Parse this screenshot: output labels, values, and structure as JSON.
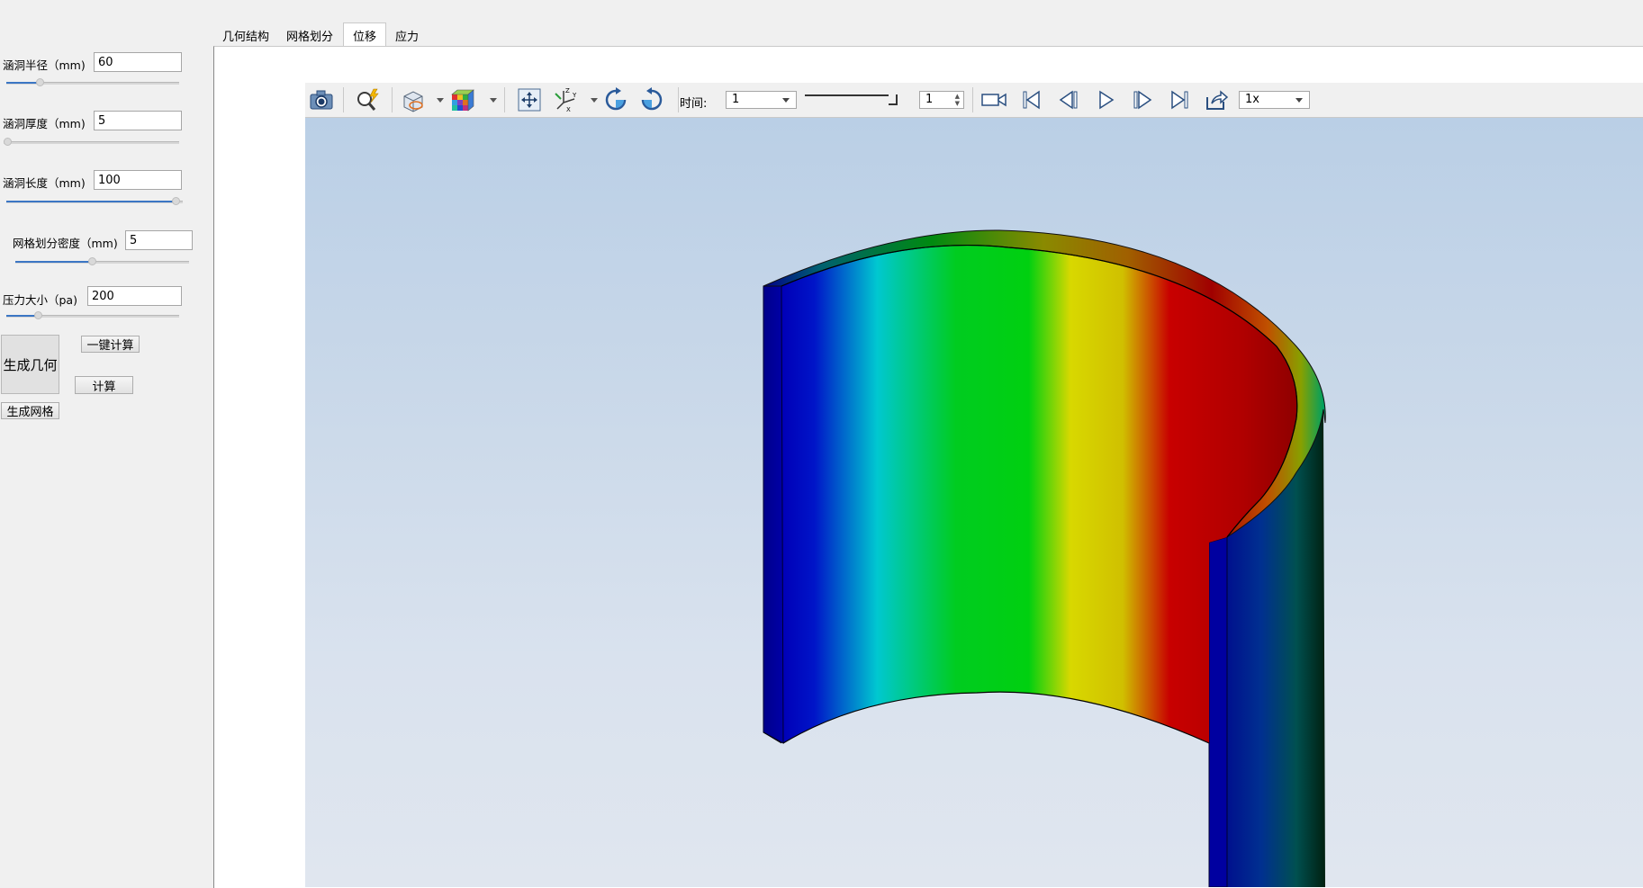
{
  "left_panel": {
    "params": [
      {
        "label": "涵洞半径（mm)",
        "value": "60",
        "level": 0.22
      },
      {
        "label": "涵洞厚度（mm)",
        "value": "5",
        "level": 0.0
      },
      {
        "label": "涵洞长度（mm)",
        "value": "100",
        "level": 1.0
      },
      {
        "label": "网格划分密度（mm)",
        "value": "5",
        "level": 0.45
      },
      {
        "label": "压力大小（pa)",
        "value": "200",
        "level": 0.2
      }
    ],
    "buttons": {
      "generate_geometry": "生成几何",
      "one_click_compute": "一键计算",
      "compute": "计算",
      "generate_mesh": "生成网格"
    }
  },
  "tabs": [
    {
      "label": "几何结构"
    },
    {
      "label": "网格划分"
    },
    {
      "label": "位移",
      "active": true
    },
    {
      "label": "应力"
    }
  ],
  "toolbar": {
    "icons": [
      "camera-icon",
      "zoom-icon",
      "display-mode-icon",
      "color-map-icon",
      "fit-view-icon",
      "axes-icon",
      "rotate-cw-icon",
      "rotate-ccw-icon",
      "record-icon",
      "first-frame-icon",
      "prev-frame-icon",
      "play-icon",
      "next-frame-icon",
      "last-frame-icon",
      "export-icon"
    ],
    "time_label": "时间:",
    "time_value": "1",
    "frame_value": "1",
    "speed_value": "1x"
  },
  "colors": {
    "viewport_top": "#bacfe6",
    "viewport_bottom": "#e0e6ef",
    "colormap": [
      "#00008b",
      "#0000ff",
      "#00c8c8",
      "#00d000",
      "#d8d800",
      "#c80000",
      "#8b0000"
    ]
  }
}
